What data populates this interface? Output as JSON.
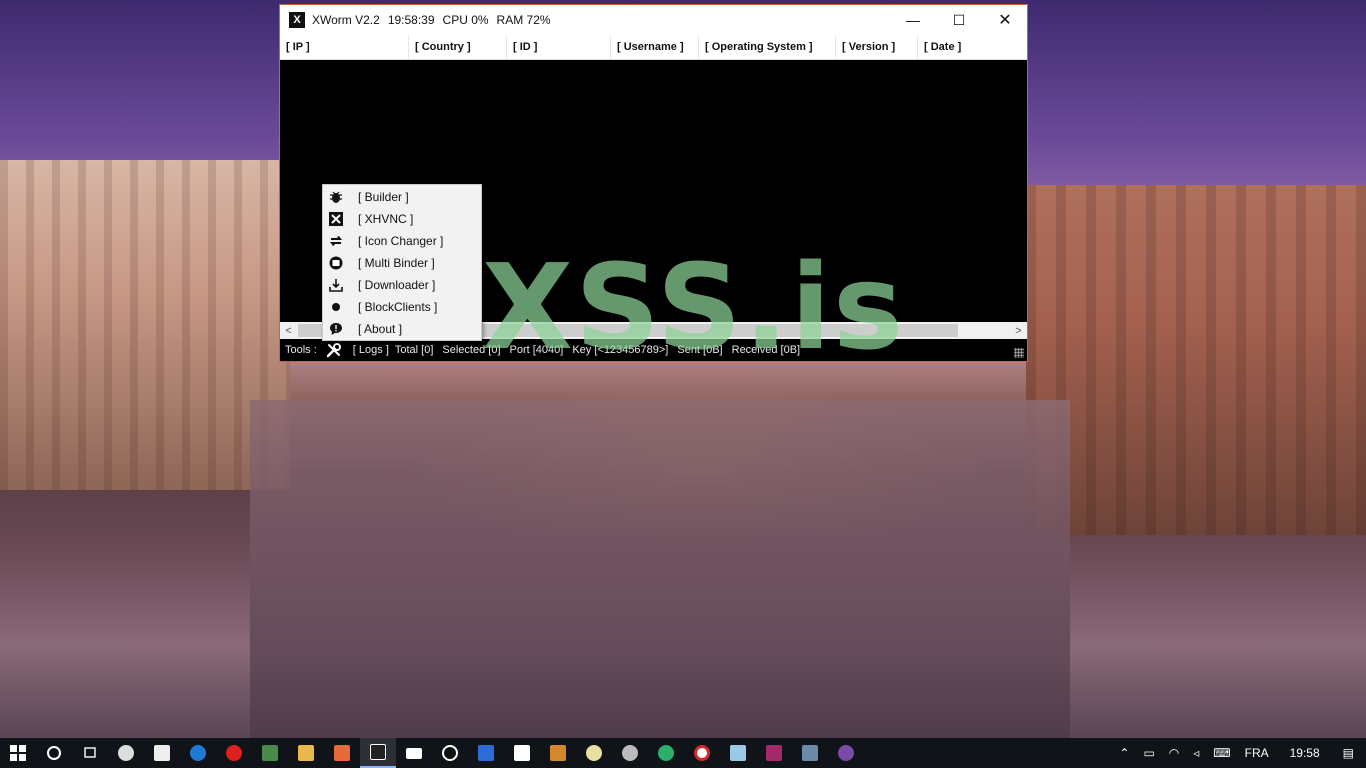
{
  "window": {
    "title_app": "XWorm V2.2",
    "title_time": "19:58:39",
    "title_cpu": "CPU 0%",
    "title_ram": "RAM 72%",
    "app_icon_glyph": "X",
    "min_glyph": "—",
    "max_glyph": "☐",
    "close_glyph": "✕"
  },
  "columns": [
    "[ IP ]",
    "[ Country ]",
    "[ ID ]",
    "[ Username ]",
    "[ Operating System ]",
    "[ Version ]",
    "[ Date ]"
  ],
  "scrollbar": {
    "left_glyph": "<",
    "right_glyph": ">"
  },
  "status": {
    "tools_label": "Tools :",
    "logs": "[ Logs ]",
    "total": "Total [0]",
    "selected": "Selected [0]",
    "port": "Port [4040]",
    "key": "Key [<123456789>]",
    "sent": "Sent [0B]",
    "received": "Received [0B]"
  },
  "tools_menu": {
    "items": [
      {
        "label": "[ Builder ]",
        "icon": "bug-icon"
      },
      {
        "label": "[ XHVNC ]",
        "icon": "xhvnc-icon"
      },
      {
        "label": "[ Icon Changer ]",
        "icon": "swap-arrows-icon"
      },
      {
        "label": "[ Multi Binder ]",
        "icon": "binder-icon"
      },
      {
        "label": "[ Downloader ]",
        "icon": "download-tray-icon"
      },
      {
        "label": "[ BlockClients ]",
        "icon": "block-dot-icon"
      },
      {
        "label": "[ About ]",
        "icon": "speech-bubble-icon"
      }
    ]
  },
  "watermark": "XSS.is",
  "taskbar": {
    "language": "FRA",
    "clock": "19:58",
    "pinned": [
      "task-view",
      "clock-app",
      "store",
      "edge",
      "opera",
      "monitor",
      "file-explorer",
      "puzzle",
      "xworm",
      "folder",
      "settings-gear",
      "shield",
      "checklist",
      "rh-tool",
      "compass",
      "circle-app",
      "edge-beta",
      "browser-red",
      "notepad",
      "winrar",
      "remote-desktop",
      "tor"
    ]
  },
  "colors": {
    "accent_border": "#c46a3a",
    "watermark": "#8cd296",
    "status_bg": "#000000"
  }
}
